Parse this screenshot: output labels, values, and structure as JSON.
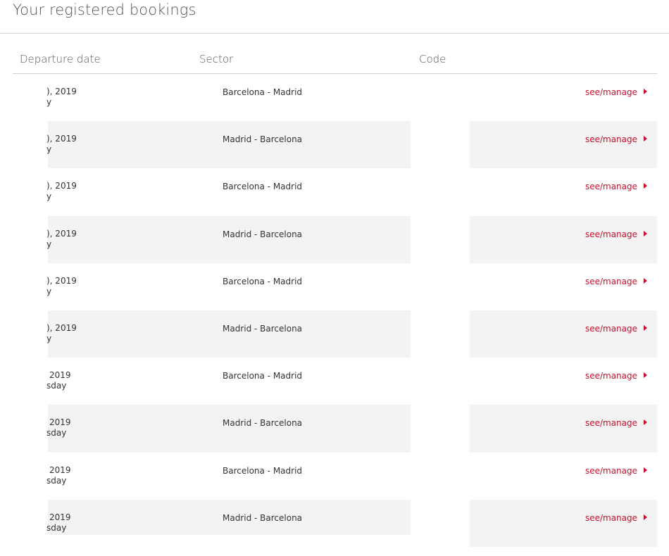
{
  "page": {
    "title": "Your registered bookings"
  },
  "table": {
    "headers": {
      "departure_date": "Departure date",
      "sector": "Sector",
      "code": "Code"
    },
    "rows": [
      {
        "date_line1": "), 2019",
        "date_line2": "y",
        "sector": "Barcelona - Madrid",
        "action": "see/manage"
      },
      {
        "date_line1": "), 2019",
        "date_line2": "y",
        "sector": "Madrid - Barcelona",
        "action": "see/manage"
      },
      {
        "date_line1": "), 2019",
        "date_line2": "y",
        "sector": "Barcelona - Madrid",
        "action": "see/manage"
      },
      {
        "date_line1": "), 2019",
        "date_line2": "y",
        "sector": "Madrid - Barcelona",
        "action": "see/manage"
      },
      {
        "date_line1": "), 2019",
        "date_line2": "y",
        "sector": "Barcelona - Madrid",
        "action": "see/manage"
      },
      {
        "date_line1": "), 2019",
        "date_line2": "y",
        "sector": "Madrid - Barcelona",
        "action": "see/manage"
      },
      {
        "date_line1": " 2019",
        "date_line2": "sday",
        "sector": "Barcelona - Madrid",
        "action": "see/manage"
      },
      {
        "date_line1": " 2019",
        "date_line2": "sday",
        "sector": "Madrid - Barcelona",
        "action": "see/manage"
      },
      {
        "date_line1": " 2019",
        "date_line2": "sday",
        "sector": "Barcelona - Madrid",
        "action": "see/manage"
      },
      {
        "date_line1": " 2019",
        "date_line2": "sday",
        "sector": "Madrid - Barcelona",
        "action": "see/manage"
      }
    ]
  },
  "colors": {
    "accent": "#c8102e",
    "row_shade": "#f3f3f3"
  },
  "icons": {
    "action_arrow": "caret-right-icon"
  }
}
